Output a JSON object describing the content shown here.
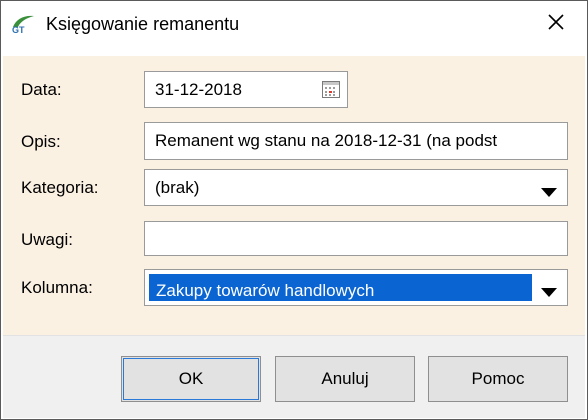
{
  "window": {
    "title": "Księgowanie remanentu"
  },
  "icons": {
    "app": "gt-app-icon",
    "close": "close-icon",
    "calendar": "calendar-icon",
    "dropdown": "chevron-down-icon"
  },
  "form": {
    "data_label": "Data:",
    "data_value": "31-12-2018",
    "opis_label": "Opis:",
    "opis_value": "Remanent wg stanu na 2018-12-31 (na podst",
    "kategoria_label": "Kategoria:",
    "kategoria_value": "(brak)",
    "uwagi_label": "Uwagi:",
    "uwagi_value": "",
    "kolumna_label": "Kolumna:",
    "kolumna_value": "Zakupy towarów handlowych"
  },
  "buttons": {
    "ok": "OK",
    "cancel": "Anuluj",
    "help": "Pomoc"
  },
  "colors": {
    "content_bg": "#fbf1e3",
    "selection": "#0a64d2",
    "footer_bg": "#f0f0f0"
  }
}
